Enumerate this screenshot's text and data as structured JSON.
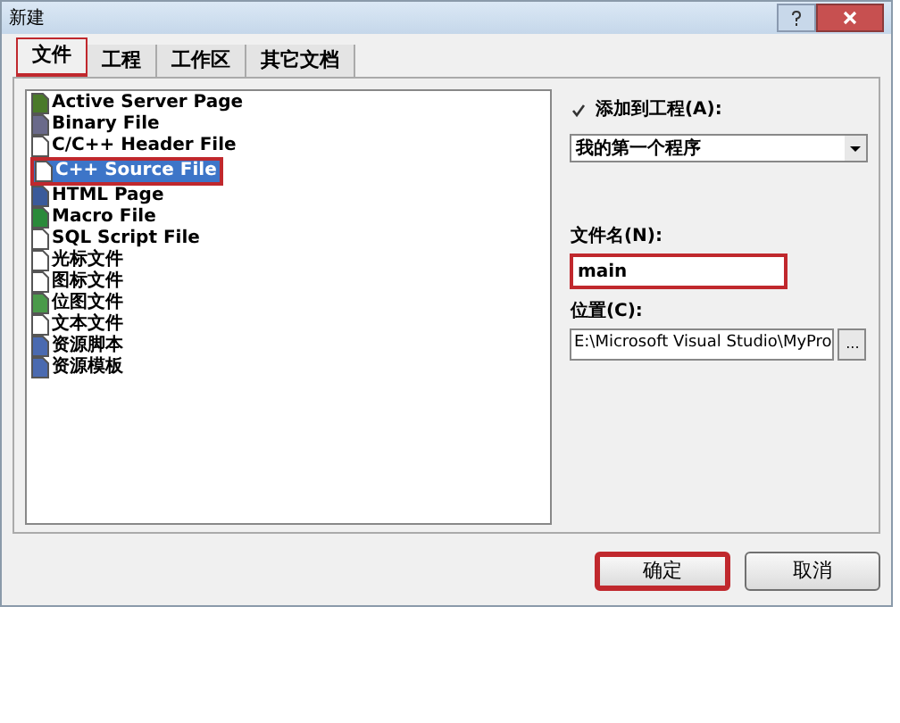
{
  "window": {
    "title": "新建"
  },
  "tabs": [
    {
      "label": "文件",
      "selected": true,
      "highlighted": true
    },
    {
      "label": "工程",
      "selected": false,
      "highlighted": false
    },
    {
      "label": "工作区",
      "selected": false,
      "highlighted": false
    },
    {
      "label": "其它文档",
      "selected": false,
      "highlighted": false
    }
  ],
  "file_types": [
    {
      "label": "Active Server Page",
      "selected": false,
      "highlighted": false
    },
    {
      "label": "Binary File",
      "selected": false,
      "highlighted": false
    },
    {
      "label": "C/C++ Header File",
      "selected": false,
      "highlighted": false
    },
    {
      "label": "C++ Source File",
      "selected": true,
      "highlighted": true
    },
    {
      "label": "HTML Page",
      "selected": false,
      "highlighted": false
    },
    {
      "label": "Macro File",
      "selected": false,
      "highlighted": false
    },
    {
      "label": "SQL Script File",
      "selected": false,
      "highlighted": false
    },
    {
      "label": "光标文件",
      "selected": false,
      "highlighted": false
    },
    {
      "label": "图标文件",
      "selected": false,
      "highlighted": false
    },
    {
      "label": "位图文件",
      "selected": false,
      "highlighted": false
    },
    {
      "label": "文本文件",
      "selected": false,
      "highlighted": false
    },
    {
      "label": "资源脚本",
      "selected": false,
      "highlighted": false
    },
    {
      "label": "资源模板",
      "selected": false,
      "highlighted": false
    }
  ],
  "add_to_project": {
    "label": "添加到工程(A):",
    "checked": true
  },
  "project_select": {
    "value": "我的第一个程序"
  },
  "file_name": {
    "label": "文件名(N):",
    "value": "main",
    "highlighted": true
  },
  "location": {
    "label": "位置(C):",
    "value": "E:\\Microsoft Visual Studio\\MyPro",
    "browse": "..."
  },
  "buttons": [
    {
      "label": "确定",
      "highlighted": true
    },
    {
      "label": "取消",
      "highlighted": false
    }
  ]
}
